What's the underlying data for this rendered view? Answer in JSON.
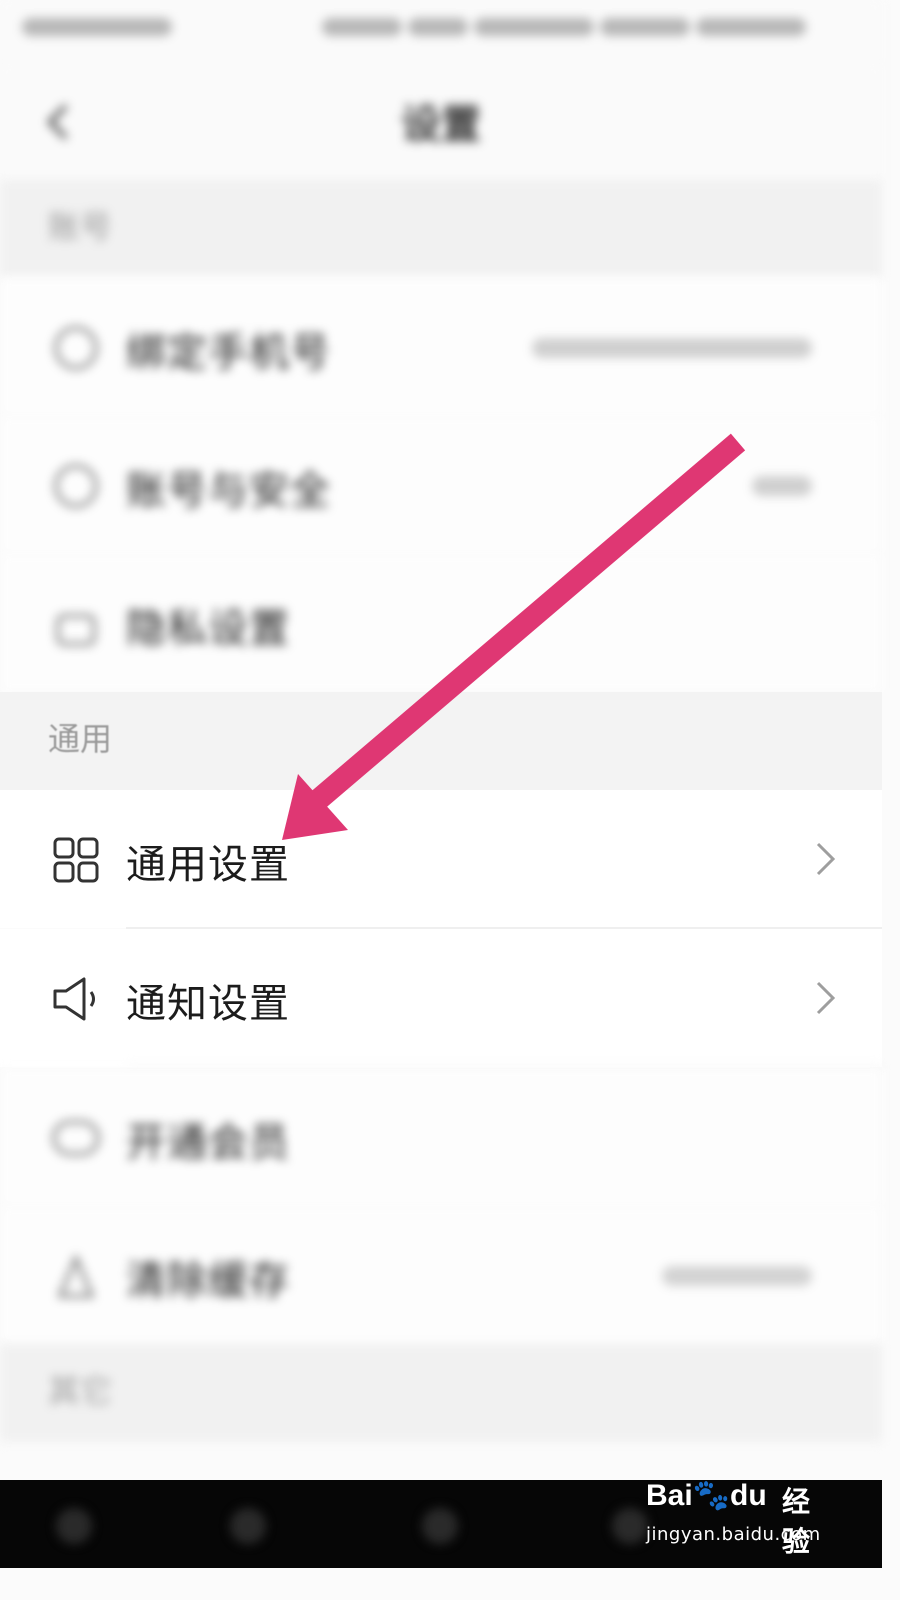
{
  "status_bar": {
    "carrier": "",
    "right": ""
  },
  "header": {
    "title": "设置",
    "back_icon": "chevron-left-icon"
  },
  "sections": [
    {
      "title": "账号",
      "items": [
        {
          "label": "绑定手机号",
          "value": "",
          "icon": "phone-icon"
        },
        {
          "label": "账号与安全",
          "value": "",
          "icon": "shield-icon"
        },
        {
          "label": "隐私设置",
          "value": "",
          "icon": "lock-icon"
        }
      ]
    },
    {
      "title": "通用",
      "items": [
        {
          "label": "通用设置",
          "icon": "grid-icon"
        },
        {
          "label": "通知设置",
          "icon": "speaker-icon"
        },
        {
          "label": "开通会员",
          "icon": "toggle-icon"
        },
        {
          "label": "清除缓存",
          "value": "",
          "icon": "trash-icon"
        }
      ]
    },
    {
      "title": "其它"
    }
  ],
  "annotation": {
    "arrow_color": "#df3773"
  },
  "watermark": {
    "brand": "Bai",
    "brand_suffix": "du",
    "product": "经验",
    "url": "jingyan.baidu.com"
  },
  "colors": {
    "background": "#fbfbfb",
    "section_bg": "#f1f1f1",
    "text": "#1c1c1c",
    "muted": "#9a9a9a",
    "navbar": "#060606"
  }
}
